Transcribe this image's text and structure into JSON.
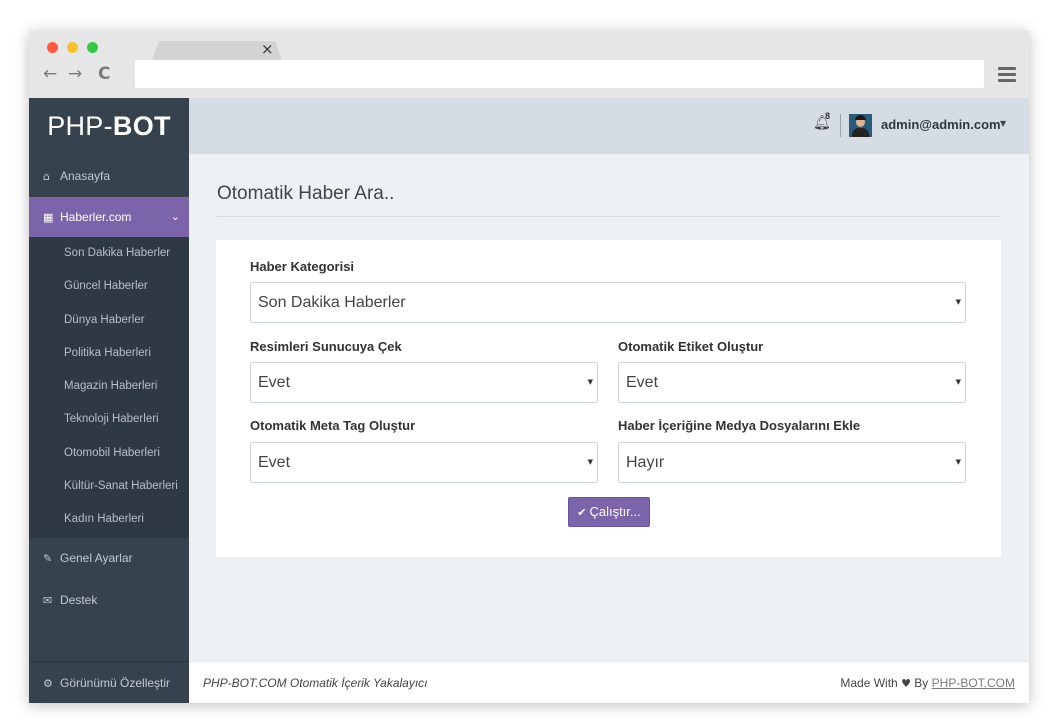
{
  "browser": {
    "tab_close": "×",
    "back": "←",
    "forward": "→",
    "reload": "C"
  },
  "brand": {
    "light": "PHP-",
    "bold": "BOT"
  },
  "sidebar": {
    "home": "Anasayfa",
    "active_section": "Haberler.com",
    "sub_items": [
      "Son Dakika Haberler",
      "Güncel Haberler",
      "Dünya Haberler",
      "Politika Haberleri",
      "Magazin Haberleri",
      "Teknoloji Haberleri",
      "Otomobil Haberleri",
      "Kültür-Sanat Haberleri",
      "Kadın Haberleri"
    ],
    "settings": "Genel Ayarlar",
    "support": "Destek",
    "customize": "Görünümü Özelleştir"
  },
  "topbar": {
    "notification_count": "8",
    "user": "admin@admin.com"
  },
  "main": {
    "title": "Otomatik Haber Ara..",
    "fields": {
      "category": {
        "label": "Haber Kategorisi",
        "value": "Son Dakika Haberler"
      },
      "images": {
        "label": "Resimleri Sunucuya Çek",
        "value": "Evet"
      },
      "tags": {
        "label": "Otomatik Etiket Oluştur",
        "value": "Evet"
      },
      "meta": {
        "label": "Otomatik Meta Tag Oluştur",
        "value": "Evet"
      },
      "media": {
        "label": "Haber İçeriğine Medya Dosyalarını Ekle",
        "value": "Hayır"
      }
    },
    "run_button": "Çalıştır..."
  },
  "footer": {
    "left": "PHP-BOT.COM Otomatik İçerik Yakalayıcı",
    "made_with": "Made With",
    "by": "By",
    "link": "PHP-BOT.COM"
  },
  "colors": {
    "sidebar": "#37424f",
    "accent": "#7b64aa",
    "topbar": "#d5dce4",
    "content_bg": "#eef1f4"
  },
  "icons": [
    "home-icon",
    "grid-icon",
    "chevron-down-icon",
    "wrench-icon",
    "envelope-icon",
    "gear-icon",
    "bell-icon",
    "check-icon",
    "heart-icon"
  ]
}
